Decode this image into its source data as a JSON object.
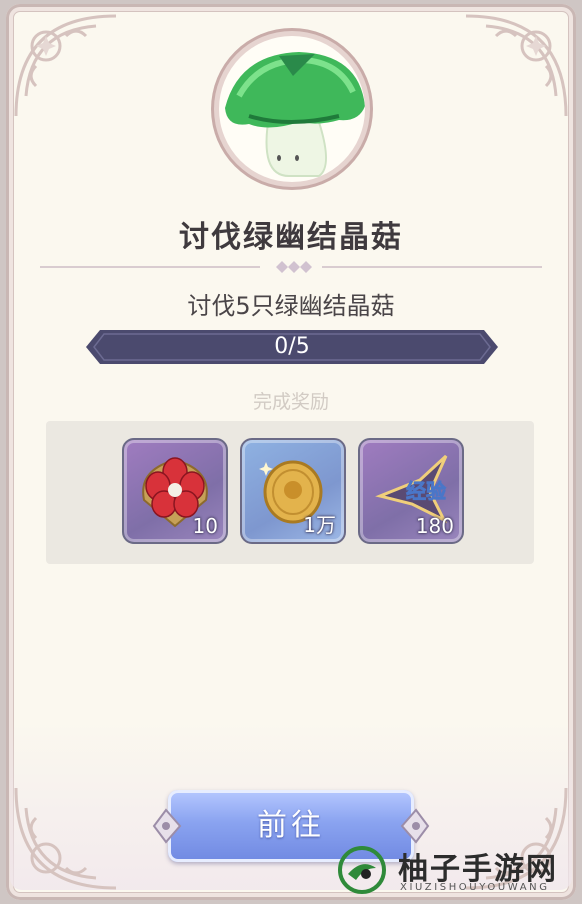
{
  "quest": {
    "title": "讨伐绿幽结晶菇",
    "description": "讨伐5只绿幽结晶菇",
    "progress_text": "0/5",
    "progress_value": 0
  },
  "rewards": {
    "heading": "完成奖励",
    "items": [
      {
        "icon": "flower-emblem-icon",
        "count": "10"
      },
      {
        "icon": "gold-coin-icon",
        "count": "1万"
      },
      {
        "icon": "exp-star-icon",
        "label": "经验",
        "count": "180"
      }
    ]
  },
  "go_button": {
    "label": "前往"
  },
  "watermark": {
    "name": "柚子手游网",
    "sub": "XIUZISHOUYOUWANG"
  },
  "colors": {
    "card_bg": "#fbf8ef",
    "progress_bar": "#4b4a6e",
    "button": "#7f97ea",
    "title_text": "#3f3a3e"
  }
}
